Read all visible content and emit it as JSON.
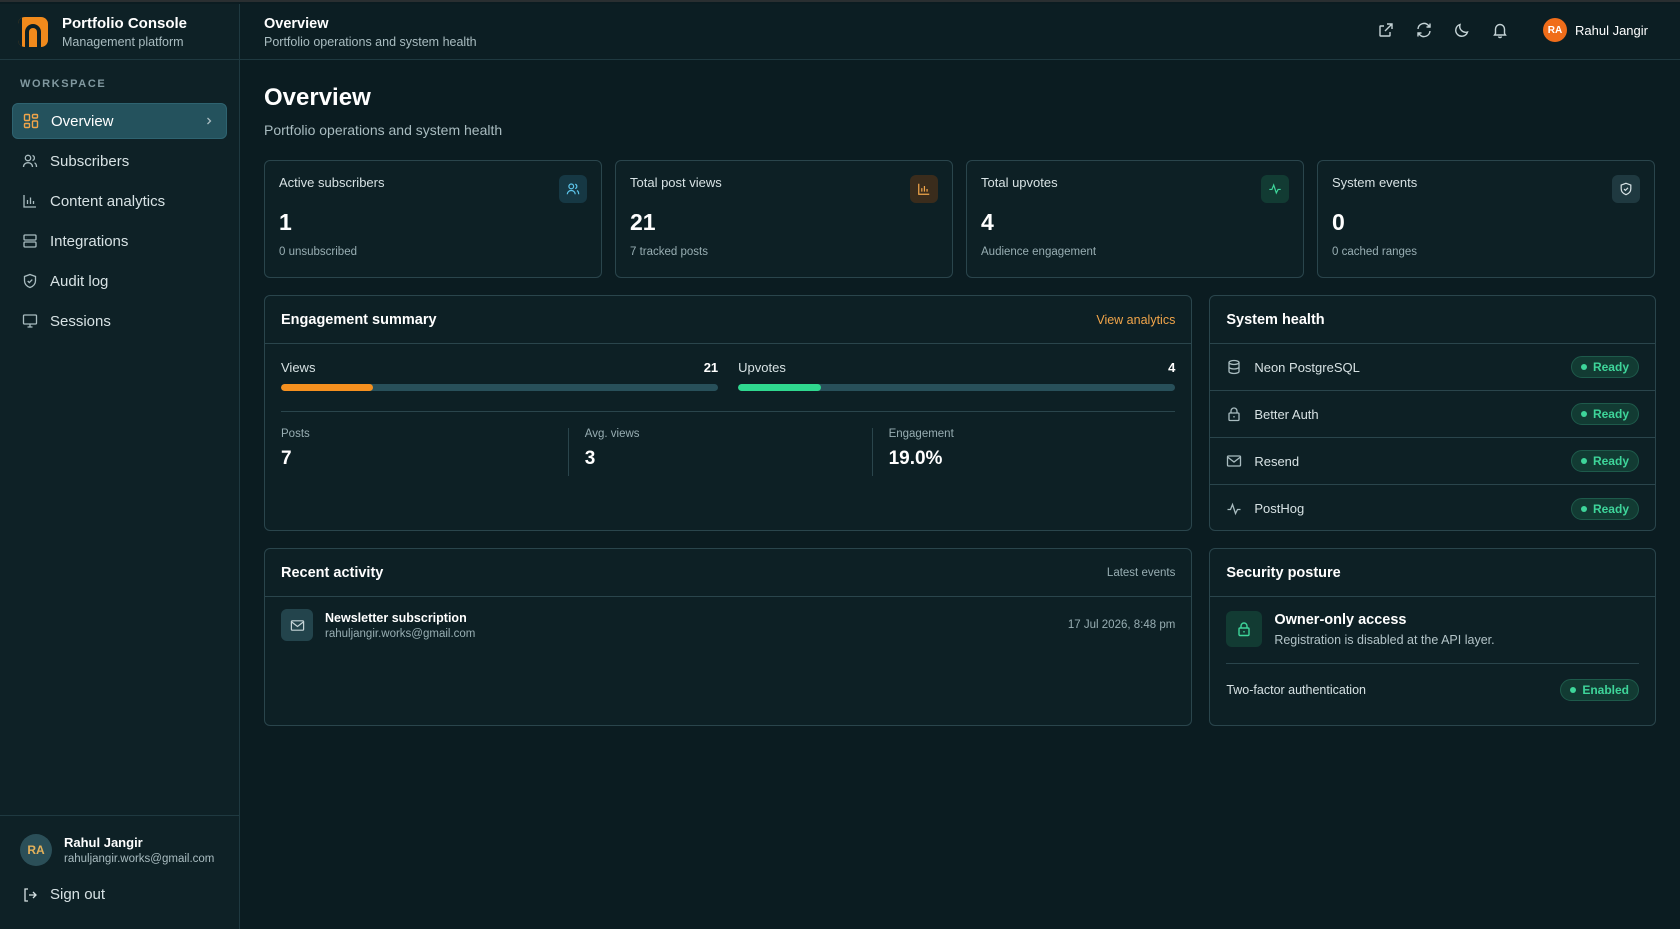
{
  "brand": {
    "title": "Portfolio Console",
    "subtitle": "Management platform"
  },
  "sidebar": {
    "section_label": "WORKSPACE",
    "items": [
      {
        "label": "Overview",
        "icon": "grid-icon",
        "active": true
      },
      {
        "label": "Subscribers",
        "icon": "users-icon"
      },
      {
        "label": "Content analytics",
        "icon": "bar-chart-icon"
      },
      {
        "label": "Integrations",
        "icon": "server-icon"
      },
      {
        "label": "Audit log",
        "icon": "shield-check-icon"
      },
      {
        "label": "Sessions",
        "icon": "monitor-icon"
      }
    ],
    "user": {
      "initials": "RA",
      "name": "Rahul Jangir",
      "email": "rahuljangir.works@gmail.com"
    },
    "sign_out": "Sign out"
  },
  "topbar": {
    "title": "Overview",
    "subtitle": "Portfolio operations and system health",
    "icons": [
      "external-link-icon",
      "refresh-icon",
      "moon-icon",
      "bell-icon"
    ],
    "user": {
      "initials": "RA",
      "name": "Rahul Jangir"
    }
  },
  "page": {
    "title": "Overview",
    "subtitle": "Portfolio operations and system health"
  },
  "stats": [
    {
      "label": "Active subscribers",
      "value": "1",
      "sub": "0 unsubscribed",
      "icon": "users-icon",
      "color": "#5cc3e8"
    },
    {
      "label": "Total post views",
      "value": "21",
      "sub": "7 tracked posts",
      "icon": "bar-chart-icon",
      "color": "#f1a54a"
    },
    {
      "label": "Total upvotes",
      "value": "4",
      "sub": "Audience engagement",
      "icon": "activity-icon",
      "color": "#3ed59a"
    },
    {
      "label": "System events",
      "value": "0",
      "sub": "0 cached ranges",
      "icon": "shield-check-icon",
      "color": "#d7e2e4"
    }
  ],
  "engagement": {
    "title": "Engagement summary",
    "link": "View analytics",
    "bars": [
      {
        "label": "Views",
        "value": "21",
        "fraction": 0.21,
        "color": "#f5901f"
      },
      {
        "label": "Upvotes",
        "value": "4",
        "fraction": 0.19,
        "color": "#2fd88f"
      }
    ],
    "metrics": [
      {
        "label": "Posts",
        "value": "7"
      },
      {
        "label": "Avg. views",
        "value": "3"
      },
      {
        "label": "Engagement",
        "value": "19.0%"
      }
    ]
  },
  "health": {
    "title": "System health",
    "rows": [
      {
        "label": "Neon PostgreSQL",
        "status": "Ready",
        "icon": "database-icon"
      },
      {
        "label": "Better Auth",
        "status": "Ready",
        "icon": "lock-icon"
      },
      {
        "label": "Resend",
        "status": "Ready",
        "icon": "mail-icon"
      },
      {
        "label": "PostHog",
        "status": "Ready",
        "icon": "activity-icon"
      }
    ]
  },
  "recent": {
    "title": "Recent activity",
    "right": "Latest events",
    "items": [
      {
        "title": "Newsletter subscription",
        "email": "rahuljangir.works@gmail.com",
        "date": "17 Jul 2026, 8:48 pm",
        "icon": "mail-icon"
      }
    ]
  },
  "security": {
    "title": "Security posture",
    "heading": "Owner-only access",
    "desc": "Registration is disabled at the API layer.",
    "tfa_label": "Two-factor authentication",
    "tfa_status": "Enabled"
  }
}
